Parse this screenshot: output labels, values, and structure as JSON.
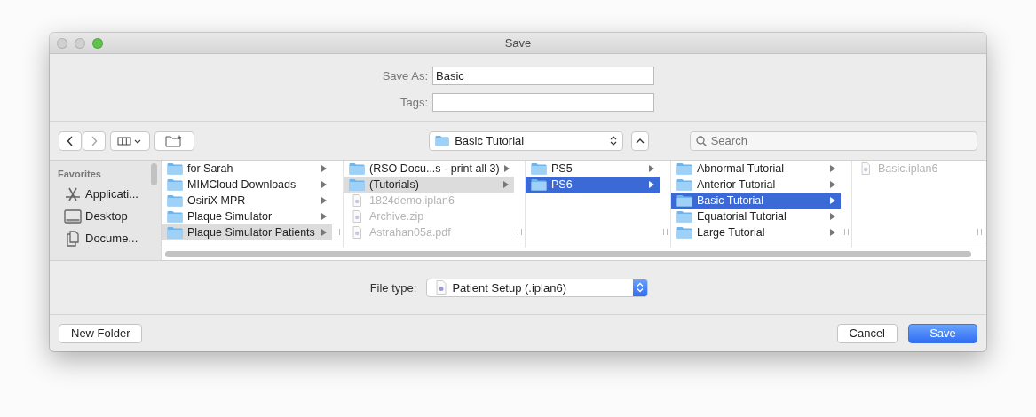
{
  "window": {
    "title": "Save",
    "buttons": [
      {
        "kind": "close"
      },
      {
        "kind": "minimize"
      },
      {
        "kind": "zoom"
      }
    ]
  },
  "save_as": {
    "label": "Save As:",
    "value": "Basic"
  },
  "tags": {
    "label": "Tags:"
  },
  "toolbar": {
    "location": "Basic Tutorial",
    "search": {
      "placeholder": "Search"
    }
  },
  "sidebar": {
    "heading": "Favorites",
    "items": [
      {
        "kind": "app",
        "label": "Applicati..."
      },
      {
        "kind": "desktop",
        "label": "Desktop"
      },
      {
        "kind": "documents",
        "label": "Docume..."
      }
    ]
  },
  "columns": [
    {
      "focused": false,
      "items": [
        {
          "kind": "folder",
          "name": "for Sarah",
          "selected": false,
          "disabled": false
        },
        {
          "kind": "folder",
          "name": "MIMCloud Downloads",
          "selected": false,
          "disabled": false
        },
        {
          "kind": "folder",
          "name": "OsiriX MPR",
          "selected": false,
          "disabled": false
        },
        {
          "kind": "folder",
          "name": "Plaque Simulator",
          "selected": false,
          "disabled": false
        },
        {
          "kind": "folder",
          "name": "Plaque Simulator Patients",
          "selected": true,
          "disabled": false
        }
      ]
    },
    {
      "focused": false,
      "items": [
        {
          "kind": "folder",
          "name": "(RSO Docu...s - print all 3)",
          "selected": false,
          "disabled": false
        },
        {
          "kind": "folder",
          "name": "(Tutorials)",
          "selected": true,
          "disabled": false
        },
        {
          "kind": "file",
          "name": "1824demo.iplan6",
          "selected": false,
          "disabled": true
        },
        {
          "kind": "file",
          "name": "Archive.zip",
          "selected": false,
          "disabled": true
        },
        {
          "kind": "file",
          "name": "Astrahan05a.pdf",
          "selected": false,
          "disabled": true
        }
      ]
    },
    {
      "focused": true,
      "items": [
        {
          "kind": "folder",
          "name": "PS5",
          "selected": false,
          "disabled": false
        },
        {
          "kind": "folder",
          "name": "PS6",
          "selected": true,
          "disabled": false
        }
      ]
    },
    {
      "focused": true,
      "items": [
        {
          "kind": "folder",
          "name": "Abnormal Tutorial",
          "selected": false,
          "disabled": false
        },
        {
          "kind": "folder",
          "name": "Anterior Tutorial",
          "selected": false,
          "disabled": false
        },
        {
          "kind": "folder",
          "name": "Basic Tutorial",
          "selected": true,
          "disabled": false
        },
        {
          "kind": "folder",
          "name": "Equatorial Tutorial",
          "selected": false,
          "disabled": false
        },
        {
          "kind": "folder",
          "name": "Large Tutorial",
          "selected": false,
          "disabled": false
        }
      ]
    },
    {
      "items": [
        {
          "kind": "file",
          "name": "Basic.iplan6",
          "selected": false,
          "disabled": true
        }
      ]
    }
  ],
  "file_type": {
    "label": "File type:",
    "value": "Patient Setup (.iplan6)"
  },
  "buttons": [
    {
      "kind": "secondary",
      "label": "New Folder"
    },
    {
      "kind": "secondary",
      "label": "Cancel"
    },
    {
      "kind": "default",
      "label": "Save"
    }
  ]
}
